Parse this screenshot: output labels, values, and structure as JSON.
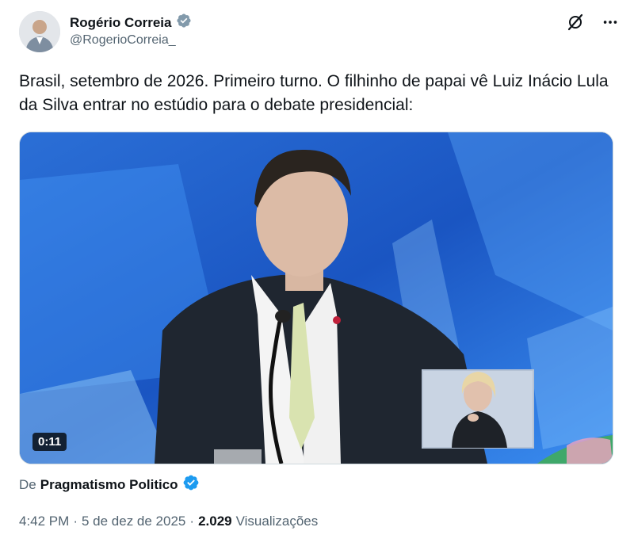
{
  "author": {
    "display_name": "Rogério Correia",
    "handle": "@RogerioCorreia_",
    "verified_badge_color": "#829aab"
  },
  "tweet": {
    "text": "Brasil, setembro de 2026. Primeiro turno. O filhinho de papai vê Luiz Inácio Lula da Silva entrar no estúdio para o debate presidencial:"
  },
  "media": {
    "duration": "0:11",
    "background_color": "#1d54b8"
  },
  "source": {
    "prefix": "De",
    "name": "Pragmatismo Politico",
    "verified_badge_color": "#1d9bf0"
  },
  "meta": {
    "time": "4:42 PM",
    "separator": "·",
    "date": "5 de dez de 2025",
    "views_count": "2.029",
    "views_label": "Visualizações"
  },
  "icons": {
    "grok": "grok-icon",
    "more": "more-icon"
  }
}
